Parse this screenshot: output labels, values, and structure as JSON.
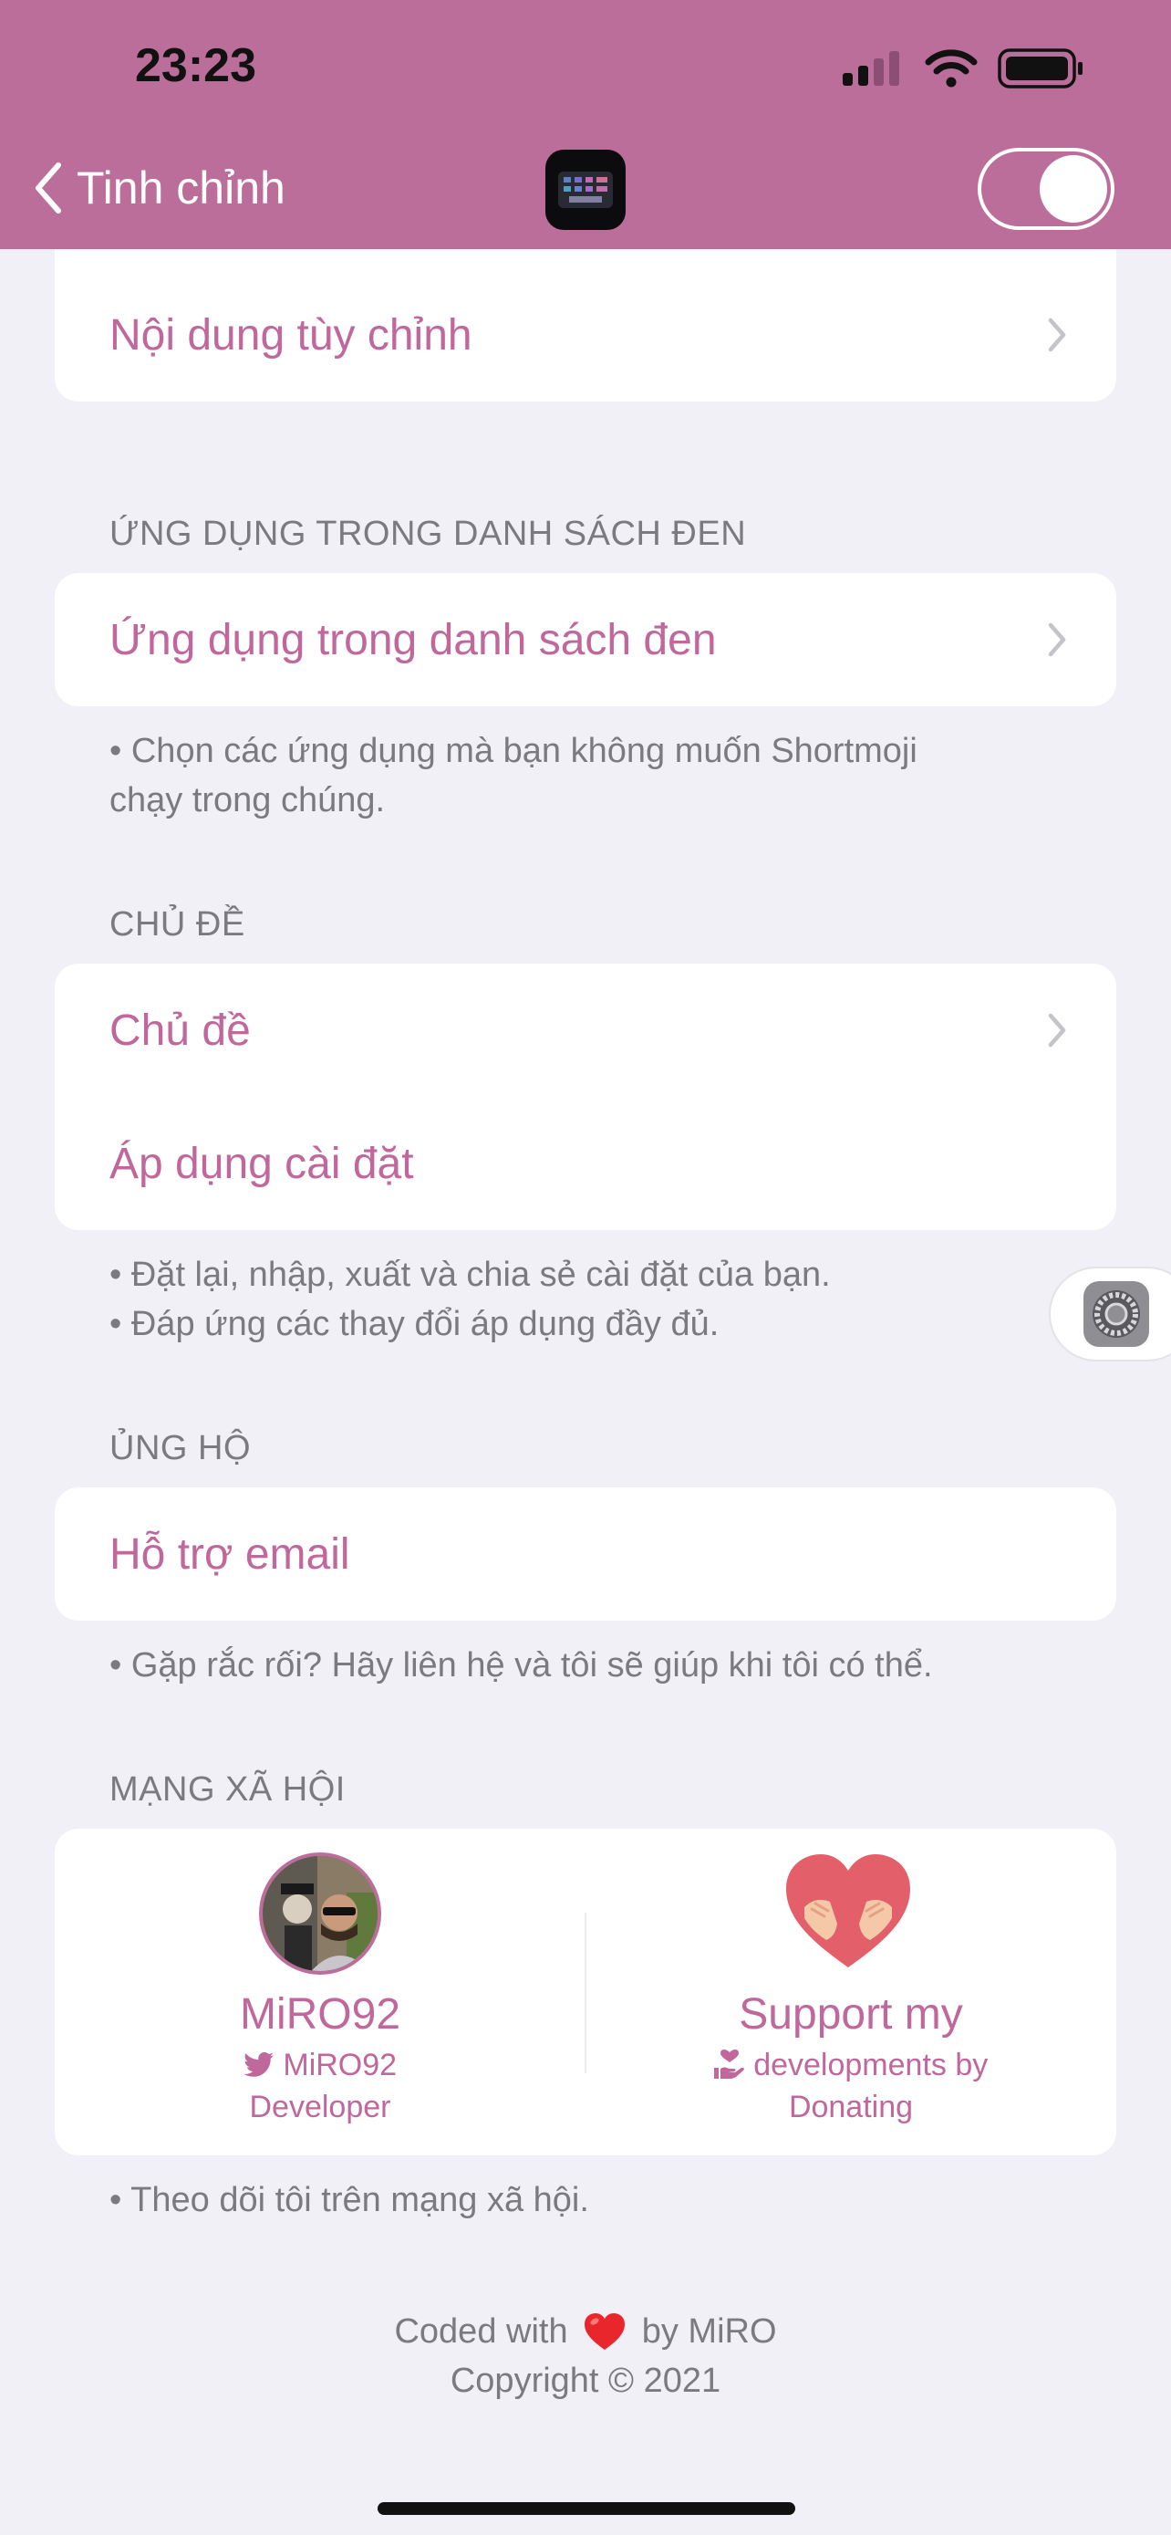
{
  "status_bar": {
    "time": "23:23"
  },
  "nav": {
    "back_label": "Tinh chỉnh",
    "toggle_on": true
  },
  "sections": {
    "custom": {
      "row_label": "Nội dung tùy chỉnh"
    },
    "blacklist": {
      "title": "ỨNG DỤNG TRONG DANH SÁCH ĐEN",
      "row_label": "Ứng dụng trong danh sách đen",
      "note_line1": "• Chọn các ứng dụng mà bạn không muốn Shortmoji",
      "note_line2": "chạy trong chúng."
    },
    "theme": {
      "title": "CHỦ ĐỀ",
      "row1_label": "Chủ đề",
      "row2_label": "Áp dụng cài đặt",
      "note_line1": "• Đặt lại, nhập, xuất và chia sẻ cài đặt của bạn.",
      "note_line2": "• Đáp ứng các thay đổi áp dụng đầy đủ."
    },
    "support": {
      "title": "ỦNG HỘ",
      "row_label": "Hỗ trợ email",
      "note": "• Gặp rắc rối? Hãy liên hệ và tôi sẽ giúp khi tôi có thể."
    },
    "social": {
      "title": "MẠNG XÃ HỘI",
      "dev_name": "MiRO92",
      "dev_handle": "MiRO92",
      "dev_role": "Developer",
      "donate_title": "Support my",
      "donate_line1": "developments by",
      "donate_line2": "Donating",
      "note": "• Theo dõi tôi trên mạng xã hội."
    }
  },
  "footer": {
    "coded_prefix": "Coded with",
    "coded_suffix": "by MiRO",
    "copyright": "Copyright © 2021"
  },
  "colors": {
    "header": "#bc6e9b",
    "accent_text": "#c0679b",
    "background": "#f1f0f6",
    "secondary_text": "#7a7a80"
  }
}
